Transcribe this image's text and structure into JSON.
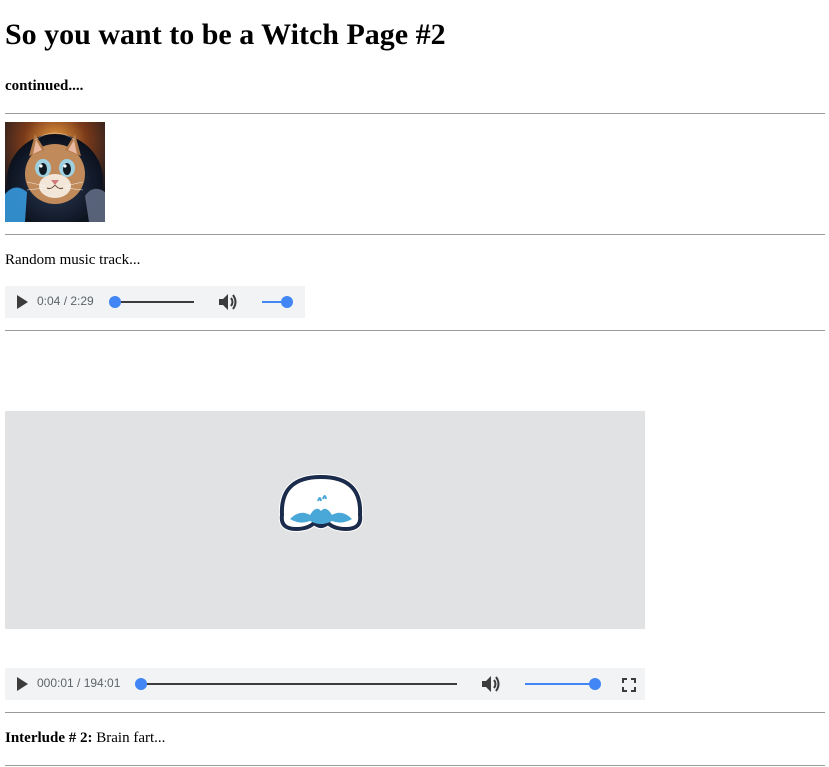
{
  "page": {
    "title": "So you want to be a Witch Page #2",
    "subtitle": "continued...."
  },
  "image": {
    "description_icon": "astronaut-cat-image"
  },
  "music": {
    "label": "Random music track...",
    "time": "0:04 / 2:29",
    "progress_fraction": 0.03,
    "volume_fraction": 1.0
  },
  "video": {
    "time": "000:01 / 194:01",
    "progress_fraction": 0.0,
    "volume_fraction": 1.0,
    "poster_icon": "jellyfish-logo-icon"
  },
  "interlude": {
    "bold": "Interlude # 2:",
    "text": "Brain fart..."
  },
  "icons": {
    "play": "play-icon",
    "volume": "volume-icon",
    "fullscreen": "fullscreen-icon"
  },
  "colors": {
    "accent": "#4285f4",
    "player_bg": "#f1f3f4",
    "video_bg": "#e1e2e4",
    "logo_dark": "#1b2b4b",
    "logo_water": "#4aa8d8"
  }
}
